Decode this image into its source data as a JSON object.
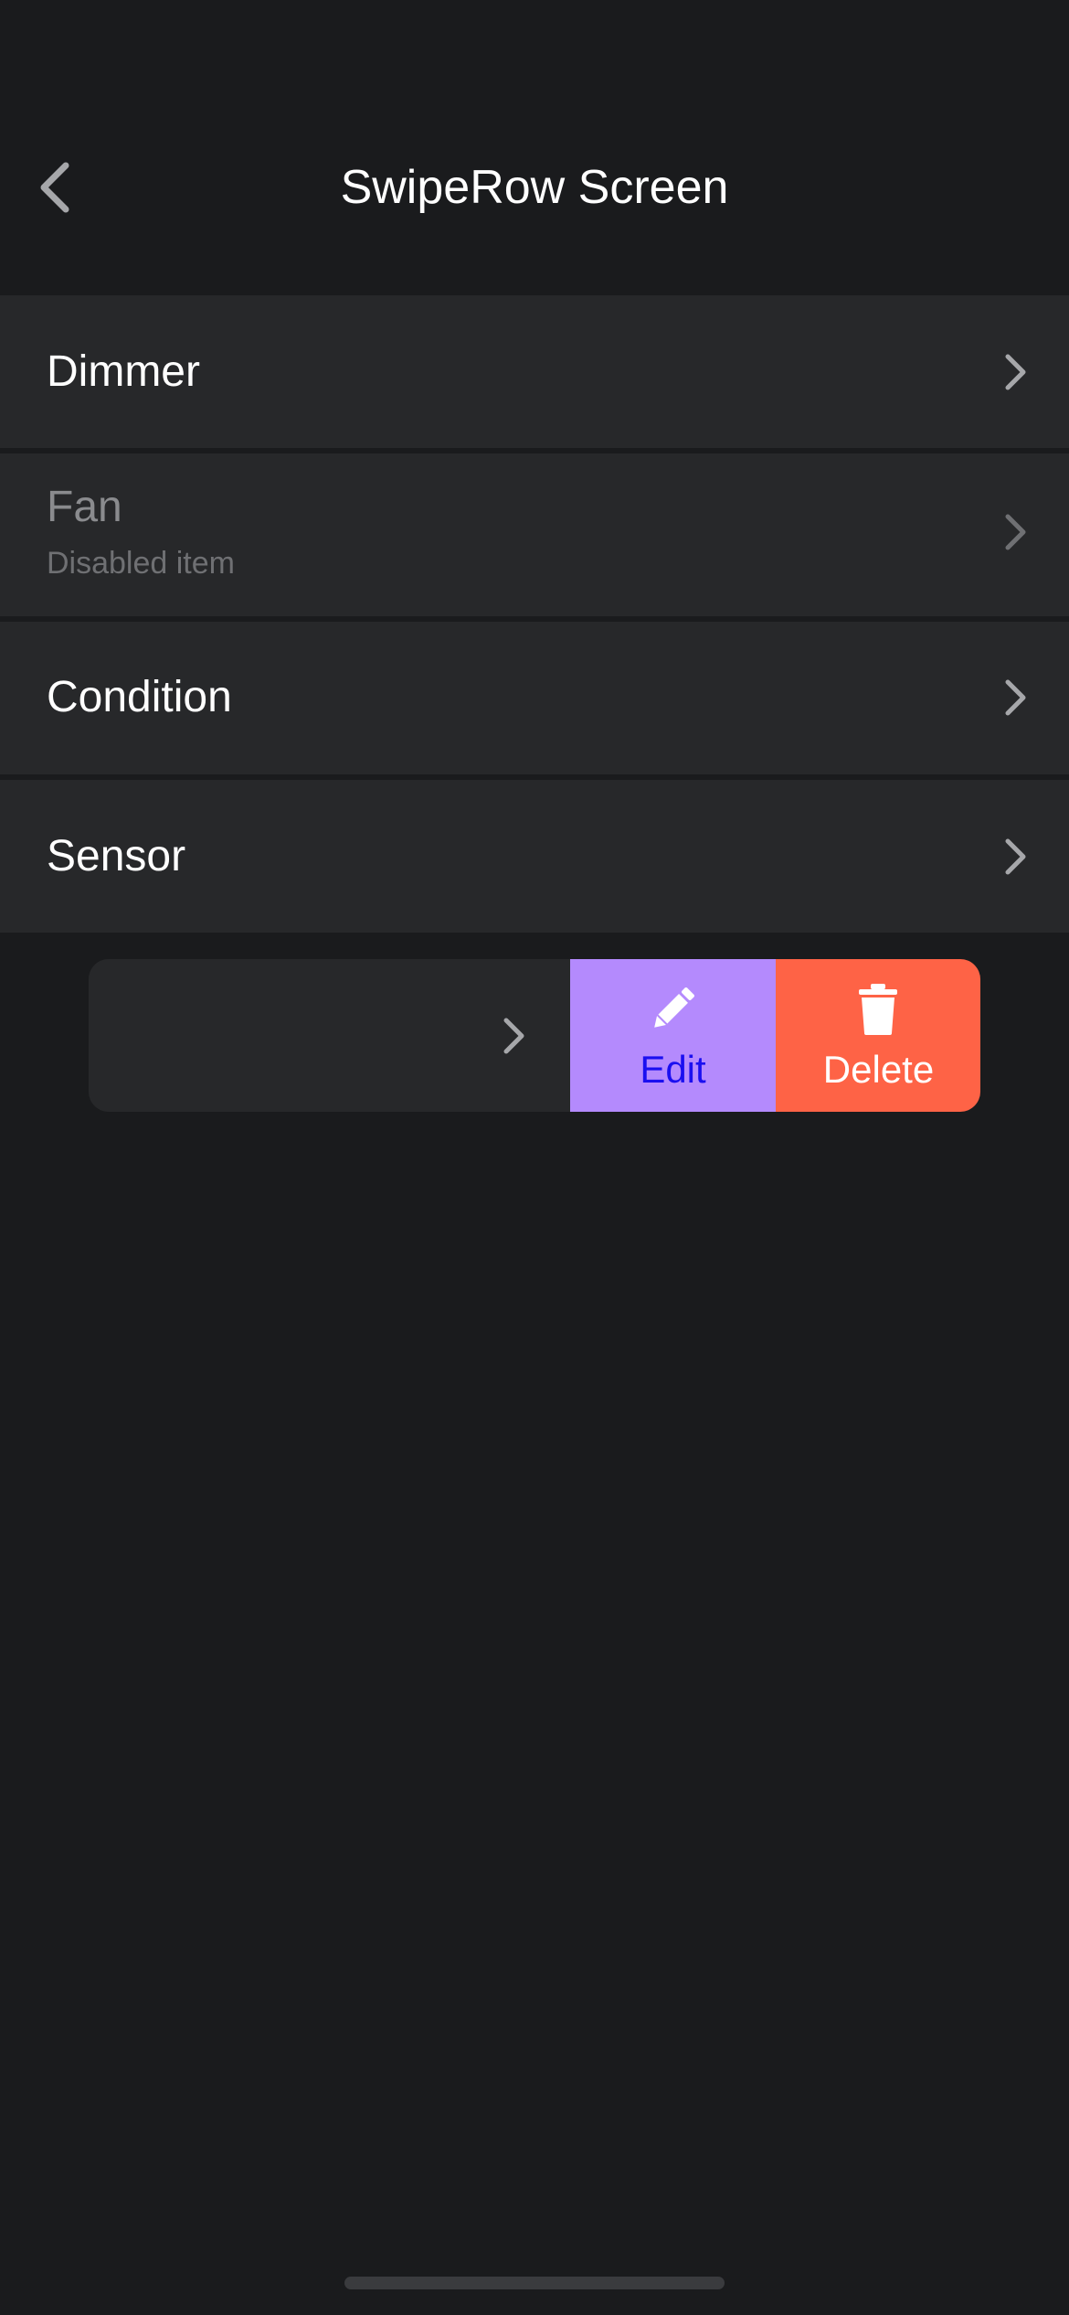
{
  "header": {
    "title": "SwipeRow Screen",
    "back_icon": "chevron-left-icon"
  },
  "rows": [
    {
      "title": "Dimmer",
      "subtitle": "",
      "disabled": false
    },
    {
      "title": "Fan",
      "subtitle": "Disabled item",
      "disabled": true
    },
    {
      "title": "Condition",
      "subtitle": "",
      "disabled": false
    },
    {
      "title": "Sensor",
      "subtitle": "",
      "disabled": false
    }
  ],
  "swipe_row": {
    "edit_label": "Edit",
    "delete_label": "Delete",
    "edit_icon": "pencil-icon",
    "delete_icon": "trash-icon"
  },
  "colors": {
    "background": "#1a1b1d",
    "row_background": "#27282a",
    "edit_action": "#b48afd",
    "delete_action": "#fe6346",
    "edit_label": "#1a0ff0"
  }
}
